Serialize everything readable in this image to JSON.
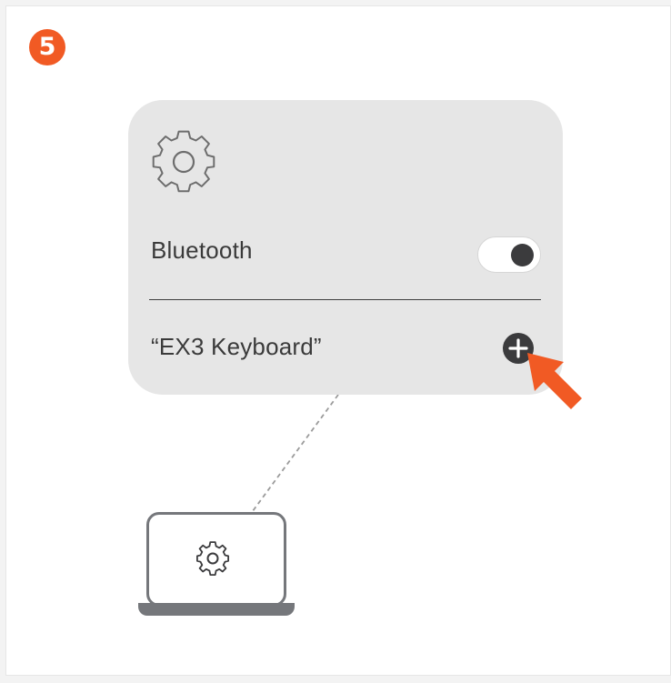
{
  "step": {
    "number": "5",
    "color": "#f15a24"
  },
  "settings_panel": {
    "icon": "gear-icon",
    "bluetooth": {
      "label": "Bluetooth",
      "toggle_on": true
    },
    "device": {
      "label": "“EX3 Keyboard”",
      "action_icon": "plus-circle-icon"
    }
  },
  "pointer": {
    "icon": "arrow-pointer-icon",
    "color": "#f15a24"
  },
  "computer": {
    "icon": "laptop-icon",
    "screen_icon": "gear-icon"
  },
  "colors": {
    "panel_bg": "#e6e6e6",
    "text": "#3a3a3a",
    "dark": "#3b3b3d",
    "laptop": "#75777b",
    "accent": "#f15a24"
  }
}
